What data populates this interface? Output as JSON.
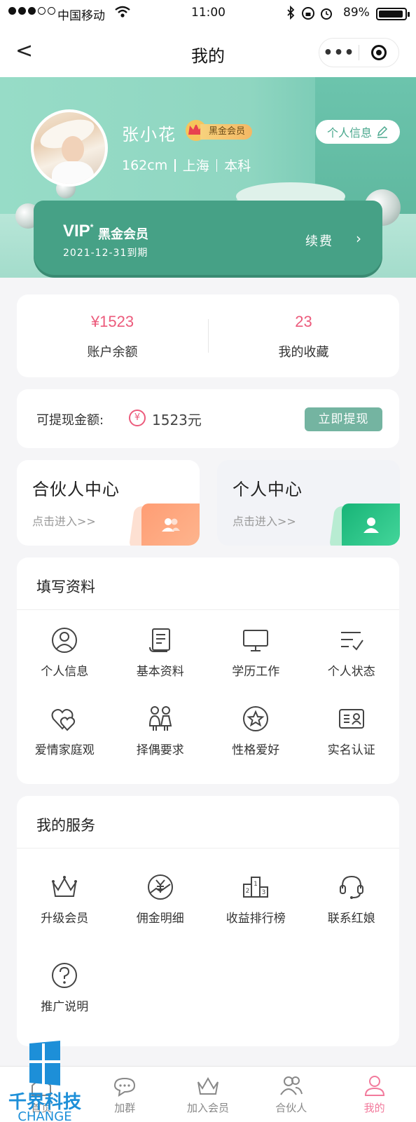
{
  "status_bar": {
    "carrier": "中国移动",
    "time": "11:00",
    "battery": "89%"
  },
  "navbar": {
    "back_icon": "<",
    "title": "我的",
    "more_icon": "•••"
  },
  "profile": {
    "name": "张小花",
    "member_badge": "黑金会员",
    "height": "162cm",
    "city": "上海",
    "education": "本科",
    "info_button": "个人信息"
  },
  "vip": {
    "vip_text": "VIP",
    "vip_star": "*",
    "level": "黑金会员",
    "expiry": "2021-12-31到期",
    "renew": "续费",
    "chevron": "›"
  },
  "stats": {
    "balance_value": "¥1523",
    "balance_label": "账户余额",
    "favorites_value": "23",
    "favorites_label": "我的收藏"
  },
  "withdraw": {
    "label": "可提现金额:",
    "yen_icon": "¥",
    "amount": "1523元",
    "button": "立即提现"
  },
  "centers": {
    "partner_title": "合伙人中心",
    "partner_sub": "点击进入>>",
    "personal_title": "个人中心",
    "personal_sub": "点击进入>>"
  },
  "profile_section": {
    "heading": "填写资料",
    "items": [
      {
        "label": "个人信息",
        "icon": "user-circle-icon"
      },
      {
        "label": "基本资料",
        "icon": "scroll-icon"
      },
      {
        "label": "学历工作",
        "icon": "monitor-icon"
      },
      {
        "label": "个人状态",
        "icon": "checklist-icon"
      },
      {
        "label": "爱情家庭观",
        "icon": "hearts-icon"
      },
      {
        "label": "择偶要求",
        "icon": "couple-icon"
      },
      {
        "label": "性格爱好",
        "icon": "star-circle-icon"
      },
      {
        "label": "实名认证",
        "icon": "id-card-icon"
      }
    ]
  },
  "service_section": {
    "heading": "我的服务",
    "items": [
      {
        "label": "升级会员",
        "icon": "crown-icon"
      },
      {
        "label": "佣金明细",
        "icon": "yen-chart-icon"
      },
      {
        "label": "收益排行榜",
        "icon": "podium-icon"
      },
      {
        "label": "联系红娘",
        "icon": "headset-icon"
      },
      {
        "label": "推广说明",
        "icon": "question-icon"
      }
    ]
  },
  "tabbar": {
    "tabs": [
      {
        "label": "首页",
        "icon": "home-icon"
      },
      {
        "label": "加群",
        "icon": "chat-icon"
      },
      {
        "label": "加入会员",
        "icon": "crown-icon"
      },
      {
        "label": "合伙人",
        "icon": "group-icon"
      },
      {
        "label": "我的",
        "icon": "profile-icon"
      }
    ],
    "active": "我的"
  },
  "watermark": {
    "text": "千界科技",
    "subtext": "CHANGE"
  },
  "colors": {
    "accent": "#46a186",
    "pink": "#ec5b7c",
    "banner": "#8fd6c1"
  }
}
